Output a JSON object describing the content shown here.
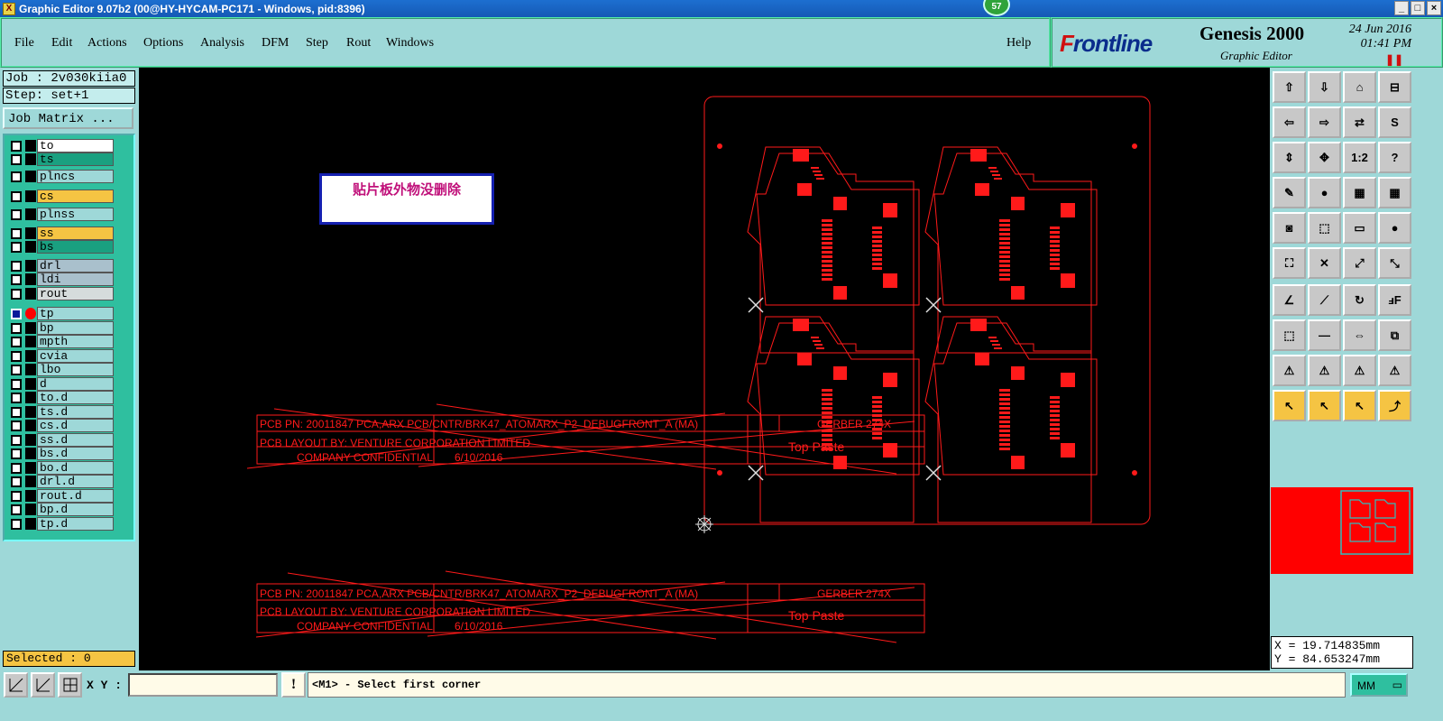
{
  "window": {
    "title": "Graphic Editor 9.07b2 (00@HY-HYCAM-PC171 - Windows, pid:8396)",
    "badge": "57",
    "app_icon": "X"
  },
  "menu": [
    "File",
    "Edit",
    "Actions",
    "Options",
    "Analysis",
    "DFM",
    "Step",
    "Rout",
    "Windows"
  ],
  "help": "Help",
  "brand": {
    "logo_prefix": "F",
    "logo_rest": "rontline",
    "product": "Genesis 2000",
    "module": "Graphic Editor",
    "date": "24 Jun 2016",
    "time": "01:41 PM"
  },
  "job": {
    "job": "Job : 2v030kiia0",
    "step": "Step: set+1",
    "matrix_button": "Job Matrix ..."
  },
  "layers": [
    {
      "name": "to",
      "color": "#ffffff"
    },
    {
      "name": "ts",
      "color": "#1aa080"
    },
    {
      "name": "plncs",
      "color": "#9ed8d8"
    },
    {
      "name": "cs",
      "color": "#f5c443"
    },
    {
      "name": "plnss",
      "color": "#9ed8d8"
    },
    {
      "name": "ss",
      "color": "#f5c443"
    },
    {
      "name": "bs",
      "color": "#1aa080"
    },
    {
      "name": "drl",
      "color": "#a9c0cc"
    },
    {
      "name": "ldi",
      "color": "#a9c0cc"
    },
    {
      "name": "rout",
      "color": "#d6dcdc"
    },
    {
      "name": "tp",
      "color": "#9ed8d8",
      "active": true
    },
    {
      "name": "bp",
      "color": "#9ed8d8"
    },
    {
      "name": "mpth",
      "color": "#9ed8d8"
    },
    {
      "name": "cvia",
      "color": "#9ed8d8"
    },
    {
      "name": "lbo",
      "color": "#9ed8d8"
    },
    {
      "name": "d",
      "color": "#9ed8d8"
    },
    {
      "name": "to.d",
      "color": "#9ed8d8"
    },
    {
      "name": "ts.d",
      "color": "#9ed8d8"
    },
    {
      "name": "cs.d",
      "color": "#9ed8d8"
    },
    {
      "name": "ss.d",
      "color": "#9ed8d8"
    },
    {
      "name": "bs.d",
      "color": "#9ed8d8"
    },
    {
      "name": "bo.d",
      "color": "#9ed8d8"
    },
    {
      "name": "drl.d",
      "color": "#9ed8d8"
    },
    {
      "name": "rout.d",
      "color": "#9ed8d8"
    },
    {
      "name": "bp.d",
      "color": "#9ed8d8"
    },
    {
      "name": "tp.d",
      "color": "#9ed8d8"
    }
  ],
  "selected": "Selected : 0",
  "note": "贴片板外物没删除",
  "board_text": {
    "row1a": "PCB PN: 20011847   PCA,ARX  PCB/CNTR/BRK47_ATOMARX_P2_DEBUGFRONT_A (MA)",
    "row1b": "GERBER 274X",
    "row2": "PCB LAYOUT BY: VENTURE CORPORATION LIMITED",
    "row2b": "Top Paste",
    "row3a": "COMPANY CONFIDENTIAL",
    "row3b": "6/10/2016"
  },
  "coords": {
    "x": "X = 19.714835mm",
    "y": "Y = 84.653247mm"
  },
  "status": {
    "xy_label": "X Y :",
    "prompt": "<M1> - Select first corner",
    "units": "MM"
  },
  "colors": {
    "board": "#ff1a1a",
    "panel": "#9ed8d8",
    "canvas": "#000000"
  }
}
